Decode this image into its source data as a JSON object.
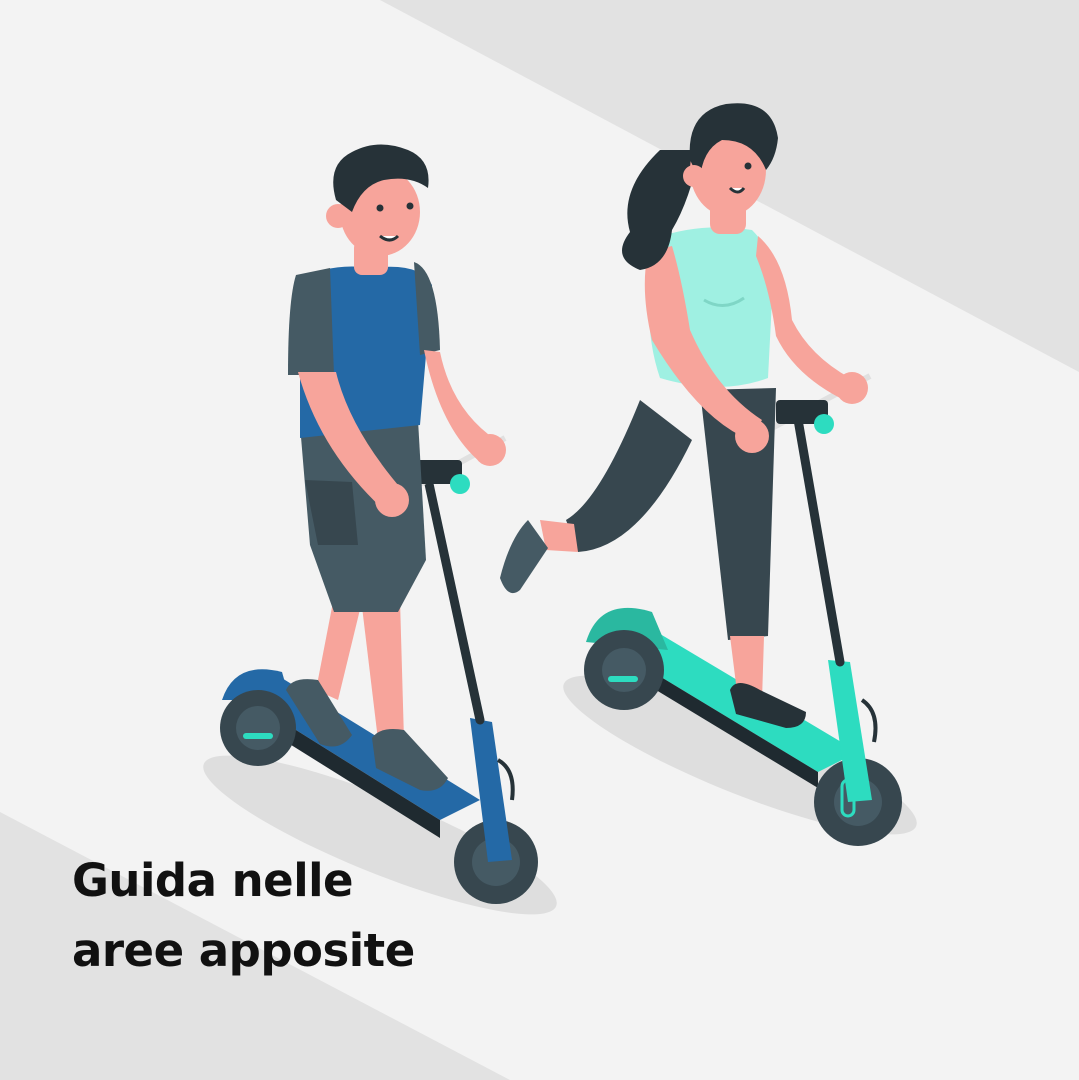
{
  "caption": {
    "line1": "Guida nelle",
    "line2": "aree apposite"
  },
  "colors": {
    "background": "#f3f3f3",
    "stripe": "#e2e2e2",
    "skin": "#f7a49b",
    "hair": "#263238",
    "man_shirt": "#2469a6",
    "man_shorts": "#455a64",
    "woman_top": "#9ff0e2",
    "woman_pants": "#37474f",
    "scooter_blue": "#2469a6",
    "scooter_teal": "#2ddcc0",
    "wheel": "#37474f",
    "shadow": "#dedede"
  },
  "icons": {
    "man": "man-riding-scooter",
    "woman": "woman-riding-scooter"
  }
}
